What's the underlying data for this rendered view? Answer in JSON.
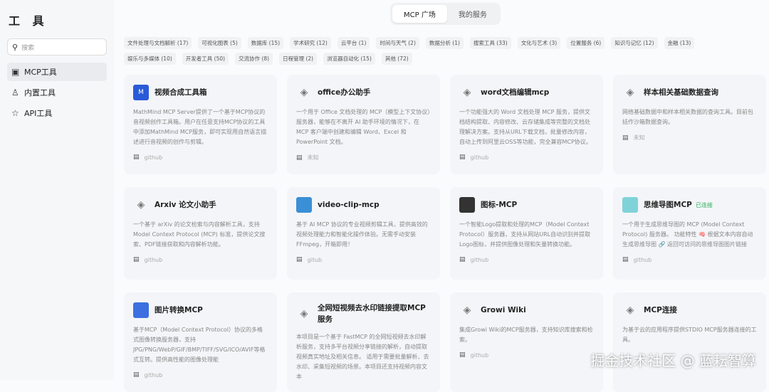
{
  "sidebar": {
    "title": "工 具",
    "search_placeholder": "搜索",
    "items": [
      {
        "label": "MCP工具",
        "icon": "grid-icon"
      },
      {
        "label": "内置工具",
        "icon": "user-icon"
      },
      {
        "label": "API工具",
        "icon": "star-icon"
      }
    ]
  },
  "tabs": [
    "MCP 广场",
    "我的服务"
  ],
  "categories": [
    "文件处理与文档解析 (17)",
    "可视化图表 (5)",
    "数据库 (15)",
    "学术研究 (12)",
    "云平台 (1)",
    "时间与天气 (2)",
    "数据分析 (1)",
    "搜索工具 (33)",
    "文化与艺术 (3)",
    "位置服务 (6)",
    "知识与记忆 (12)",
    "金融 (13)",
    "娱乐与多媒体 (10)",
    "开发者工具 (50)",
    "交流协作 (8)",
    "日程管理 (2)",
    "浏览器自动化 (15)",
    "其他 (72)"
  ],
  "cards": [
    {
      "title": "视频合成工具箱",
      "desc": "MathMind MCP Server提供了一个基于MCP协议的音视频创作工具箱。用户在任意支持MCP协议的工具中添加MathMind MCP服务，即可实现用自然语言描述进行音视频的创作与剪辑。",
      "source": "github",
      "icon": "mathmind-logo",
      "color": "#2a5bd7"
    },
    {
      "title": "office办公助手",
      "desc": "一个用于 Office 文档处理的 MCP（模型上下文协议）服务器，能够在不离开 AI 助手环境的情况下，在 MCP 客户端中创建和编辑 Word、Excel 和 PowerPoint 文档。",
      "source": "未知",
      "icon": "mcp-logo"
    },
    {
      "title": "word文档编辑mcp",
      "desc": "一个功能强大的 Word 文档处理 MCP 服务，提供文档结构提取、内容修改、云存储集成等完整的文档处理解决方案。支持从URL下载文档，批量修改内容，自动上传到阿里云OSS等功能，完全兼容MCP协议。",
      "source": "github",
      "icon": "mcp-logo"
    },
    {
      "title": "样本相关基础数据查询",
      "desc": "网络基础数据中和样本相关数据的查询工具。目前包括作沙箱数据查询。",
      "source": "未知",
      "icon": "mcp-logo"
    },
    {
      "title": "Arxiv 论文小助手",
      "desc": "一个基于 arXiv 的论文检索与内容解析工具，支持 Model Context Protocol (MCP) 标准，提供论文搜索、PDF链接获取和内容解析功能。",
      "source": "github",
      "icon": "mcp-logo"
    },
    {
      "title": "video-clip-mcp",
      "desc": "基于 AI MCP 协议的专业视频剪辑工具，提供高效的视频处理能力和智能化操作体验。无需手动安装 FFmpeg，开箱即用！",
      "source": "gitub",
      "icon": "video-clip-logo",
      "color": "#3b8fd6"
    },
    {
      "title": "图标-MCP",
      "desc": "一个智能Logo提取和处理的MCP（Model Context Protocol）服务器，支持从网站URL自动识别并提取Logo图标，并提供图像处理和矢量转换功能。",
      "source": "github",
      "icon": "logo-mcp-icon",
      "color": "#333"
    },
    {
      "title": "思维导图MCP",
      "badge": "已连接",
      "desc": "一个用于生成思维导图的 MCP (Model Context Protocol) 服务器。 功能特性 🧠 根据文本内容自动生成思维导图 🔗 返回可访问的思维导图图片链接",
      "source": "github",
      "icon": "mindmap-logo",
      "color": "#7fd3d8"
    },
    {
      "title": "图片转换MCP",
      "desc": "基于MCP（Model Context Protocol）协议的多格式图像转换服务器，支持JPG/PNG/WebP/GIF/BMP/TIFF/SVG/ICO/AVIF等格式互转。提供高性能的图像处理能",
      "source": "github",
      "icon": "image-convert-logo",
      "color": "#3d6fe0"
    },
    {
      "title": "全网短视频去水印链接提取MCP服务",
      "desc": "本项目是一个基于 FastMCP 的全网短视频去水印解析服务，支持多平台视频分享链接的解析，自动提取视频真实地址及相关信息。 适用于需要批量解析、去水印、采集短视频的场景。本项目还支持视频内容文本",
      "source": "",
      "icon": "mcp-logo"
    },
    {
      "title": "Growi Wiki",
      "desc": "集成Growi Wiki的MCP服务器，支持知识库搜索和检索。",
      "source": "github",
      "icon": "mcp-logo"
    },
    {
      "title": "MCP连接",
      "desc": "为基于云的应用程序提供STDIO MCP服务器连接的工具。",
      "source": "",
      "icon": "mcp-logo"
    }
  ],
  "watermark": "掘金技术社区 @ 蓝耘智算"
}
